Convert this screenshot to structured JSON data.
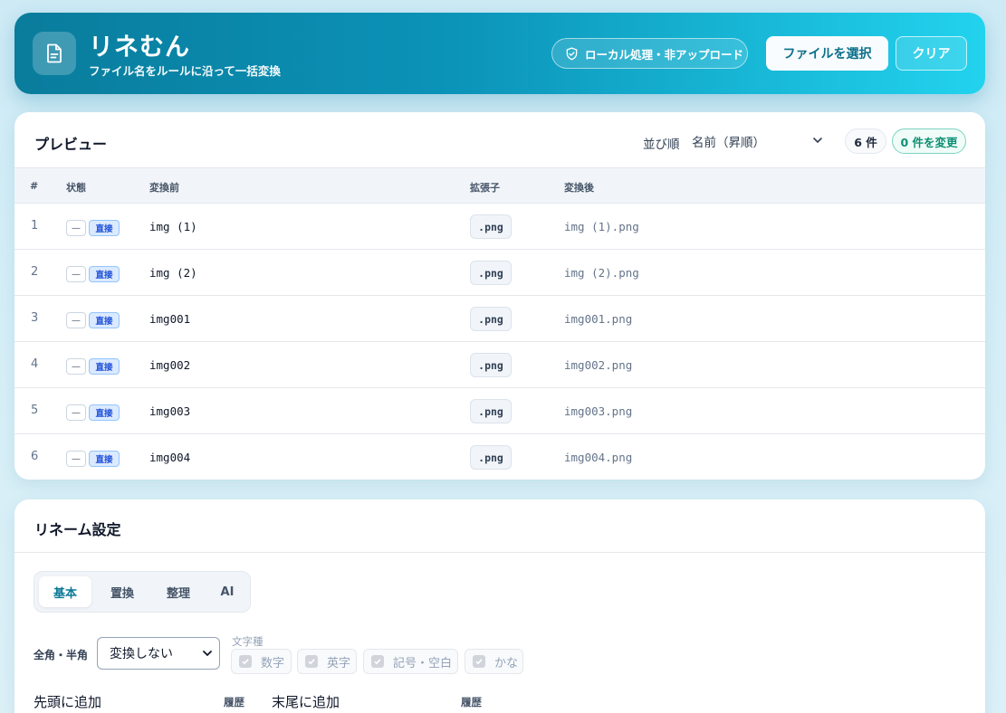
{
  "header": {
    "title": "リネむん",
    "subtitle": "ファイル名をルールに沿って一括変換",
    "local_badge": "ローカル処理・非アップロード",
    "select_button": "ファイルを選択",
    "clear_button": "クリア",
    "logo_icon": "file-icon",
    "badge_icon": "shield-check-icon"
  },
  "preview": {
    "title": "プレビュー",
    "sort_label": "並び順",
    "sort_value": "名前（昇順）",
    "count_badge": "6 件",
    "changed_badge": "0 件を変更",
    "columns": {
      "num": "#",
      "status": "状態",
      "before": "変換前",
      "ext": "拡張子",
      "after": "変換後"
    },
    "rows": [
      {
        "num": "1",
        "status": "—",
        "badge": "直接",
        "before": "img (1)",
        "ext": ".png",
        "after": "img (1).png"
      },
      {
        "num": "2",
        "status": "—",
        "badge": "直接",
        "before": "img (2)",
        "ext": ".png",
        "after": "img (2).png"
      },
      {
        "num": "3",
        "status": "—",
        "badge": "直接",
        "before": "img001",
        "ext": ".png",
        "after": "img001.png"
      },
      {
        "num": "4",
        "status": "—",
        "badge": "直接",
        "before": "img002",
        "ext": ".png",
        "after": "img002.png"
      },
      {
        "num": "5",
        "status": "—",
        "badge": "直接",
        "before": "img003",
        "ext": ".png",
        "after": "img003.png"
      },
      {
        "num": "6",
        "status": "—",
        "badge": "直接",
        "before": "img004",
        "ext": ".png",
        "after": "img004.png"
      }
    ]
  },
  "settings": {
    "title": "リネーム設定",
    "tabs": [
      "基本",
      "置換",
      "整理",
      "AI"
    ],
    "active_tab": "基本",
    "width_label": "全角・半角",
    "width_value": "変換しない",
    "chartype_label": "文字種",
    "chartypes": [
      "数字",
      "英字",
      "記号・空白",
      "かな"
    ],
    "prefix_label": "先頭に追加",
    "prefix_history": "履歴",
    "suffix_label": "末尾に追加",
    "suffix_history": "履歴"
  },
  "colors": {
    "accent": "#0b93b8",
    "header_gradient_end": "#22d3ee",
    "changed_green": "#0f8f73",
    "direct_blue": "#1d4ed8"
  }
}
